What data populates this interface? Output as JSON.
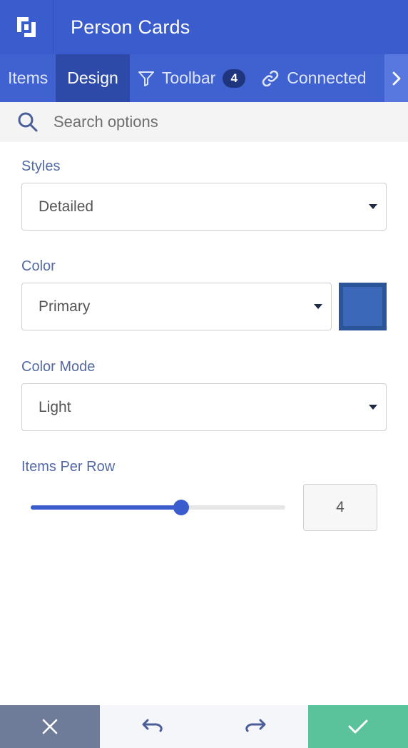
{
  "header": {
    "title": "Person Cards",
    "logo_icon": "app-logo-icon"
  },
  "tabs": [
    {
      "label": "Items",
      "active": false
    },
    {
      "label": "Design",
      "active": true
    },
    {
      "label": "Toolbar",
      "icon": "filter-icon",
      "badge": "4",
      "active": false
    },
    {
      "label": "Connected",
      "icon": "link-icon",
      "active": false
    }
  ],
  "search": {
    "placeholder": "Search options",
    "value": ""
  },
  "fields": {
    "styles": {
      "label": "Styles",
      "value": "Detailed"
    },
    "color": {
      "label": "Color",
      "value": "Primary",
      "swatch": "#3c68ba"
    },
    "color_mode": {
      "label": "Color Mode",
      "value": "Light"
    },
    "items_per_row": {
      "label": "Items Per Row",
      "value": "4",
      "slider_fraction": 0.59
    }
  },
  "footer": {
    "cancel_icon": "close-icon",
    "undo_icon": "undo-icon",
    "redo_icon": "redo-icon",
    "confirm_icon": "check-icon"
  },
  "colors": {
    "header": "#3a5ccc",
    "tab_active": "#2d4aa8",
    "label": "#5369a4",
    "cancel": "#6e7b99",
    "confirm": "#5bc39b"
  }
}
